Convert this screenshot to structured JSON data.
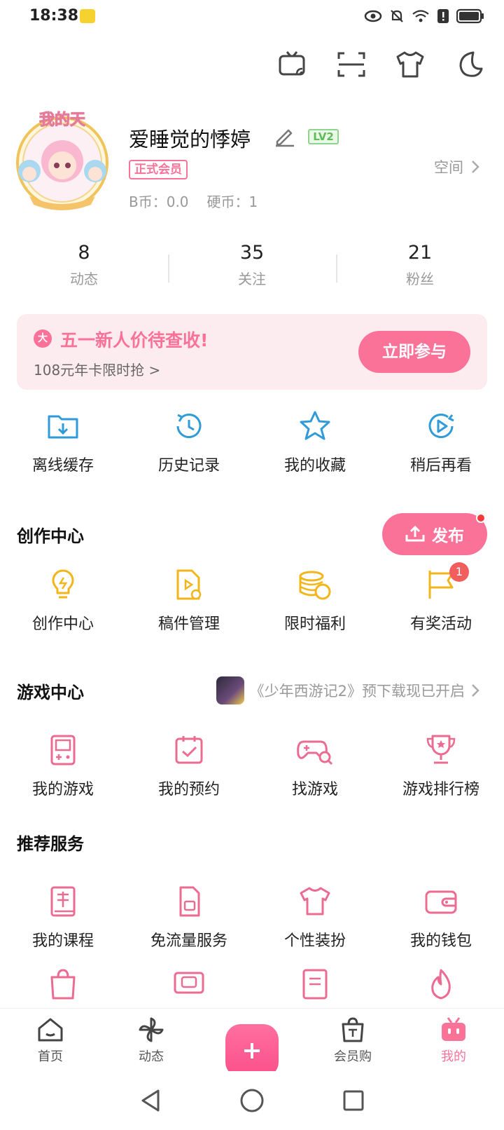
{
  "status_bar": {
    "time": "18:38"
  },
  "profile": {
    "username": "爱睡觉的悸婷",
    "level": "LV2",
    "vip": "正式会员",
    "space_link": "空间",
    "b_coin": "B币：0.0",
    "coin": "硬币：1",
    "avatar_label": "我的天"
  },
  "stats": [
    {
      "num": "8",
      "label": "动态"
    },
    {
      "num": "35",
      "label": "关注"
    },
    {
      "num": "21",
      "label": "粉丝"
    }
  ],
  "promo": {
    "badge": "大",
    "title": "五一新人价待查收!",
    "subtitle": "108元年卡限时抢 >",
    "button": "立即参与"
  },
  "quick": [
    {
      "label": "离线缓存",
      "icon": "download-folder-icon"
    },
    {
      "label": "历史记录",
      "icon": "history-clock-icon"
    },
    {
      "label": "我的收藏",
      "icon": "star-icon"
    },
    {
      "label": "稍后再看",
      "icon": "play-later-icon"
    }
  ],
  "creator": {
    "title": "创作中心",
    "publish": "发布",
    "items": [
      {
        "label": "创作中心",
        "icon": "lightbulb-icon"
      },
      {
        "label": "稿件管理",
        "icon": "video-file-icon"
      },
      {
        "label": "限时福利",
        "icon": "coins-icon"
      },
      {
        "label": "有奖活动",
        "icon": "flag-icon",
        "badge": "1"
      }
    ]
  },
  "games": {
    "title": "游戏中心",
    "promo_text": "《少年西游记2》预下载现已开启",
    "items": [
      {
        "label": "我的游戏",
        "icon": "gameboy-icon"
      },
      {
        "label": "我的预约",
        "icon": "calendar-check-icon"
      },
      {
        "label": "找游戏",
        "icon": "gamepad-search-icon"
      },
      {
        "label": "游戏排行榜",
        "icon": "trophy-icon"
      }
    ]
  },
  "services": {
    "title": "推荐服务",
    "items": [
      {
        "label": "我的课程",
        "icon": "course-book-icon"
      },
      {
        "label": "免流量服务",
        "icon": "sim-card-icon"
      },
      {
        "label": "个性装扮",
        "icon": "tshirt-icon"
      },
      {
        "label": "我的钱包",
        "icon": "wallet-icon"
      }
    ]
  },
  "nav": [
    {
      "label": "首页",
      "icon": "home-icon"
    },
    {
      "label": "动态",
      "icon": "pinwheel-icon"
    },
    {
      "label": "",
      "icon": "plus-icon"
    },
    {
      "label": "会员购",
      "icon": "shopping-bag-icon"
    },
    {
      "label": "我的",
      "icon": "tv-mine-icon"
    }
  ],
  "colors": {
    "accent": "#fb7299",
    "blue": "#2f9bd8",
    "gold": "#f2b51a",
    "pink_icon": "#ec6b91"
  }
}
